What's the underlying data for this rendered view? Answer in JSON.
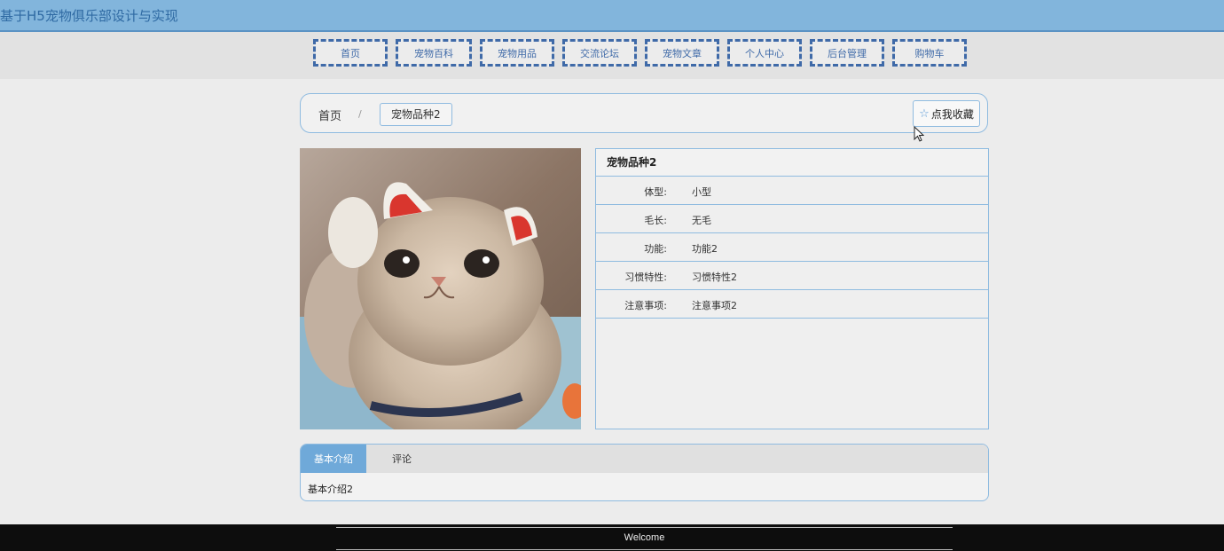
{
  "header": {
    "title": "基于H5宠物俱乐部设计与实现"
  },
  "nav": {
    "items": [
      "首页",
      "宠物百科",
      "宠物用品",
      "交流论坛",
      "宠物文章",
      "个人中心",
      "后台管理",
      "购物车"
    ]
  },
  "breadcrumb": {
    "home": "首页",
    "separator": "/",
    "current": "宠物品种2",
    "favorite_label": "点我收藏",
    "favorite_icon": "star-icon"
  },
  "detail": {
    "title": "宠物品种2",
    "fields": [
      {
        "label": "体型:",
        "value": "小型"
      },
      {
        "label": "毛长:",
        "value": "无毛"
      },
      {
        "label": "功能:",
        "value": "功能2"
      },
      {
        "label": "习惯特性:",
        "value": "习惯特性2"
      },
      {
        "label": "注意事项:",
        "value": "注意事项2"
      }
    ]
  },
  "tabs": {
    "items": [
      "基本介绍",
      "评论"
    ],
    "active": "基本介绍",
    "content": "基本介绍2"
  },
  "footer": {
    "text": "Welcome"
  },
  "colors": {
    "accent": "#82b5dc",
    "nav_border": "#3f6aa8",
    "footer_bg": "#0d0d0d"
  }
}
